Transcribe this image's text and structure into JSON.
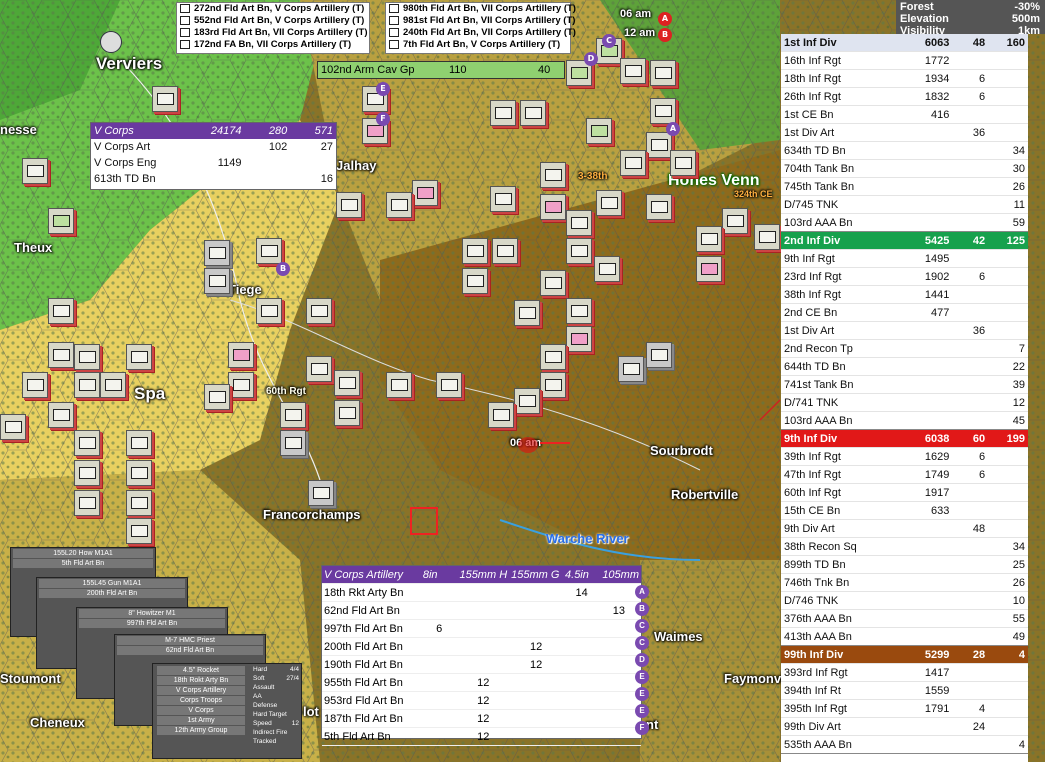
{
  "weather": {
    "terrain": "Forest",
    "terrain_value": "-30%",
    "elevation_label": "Elevation",
    "elevation_value": "500m",
    "visibility_label": "Visibility",
    "visibility_value": "1km"
  },
  "top_tooltip_left": [
    "272nd Fld Art Bn, V Corps Artillery (T)",
    "552nd Fld Art Bn, V Corps Artillery (T)",
    "183rd Fld Art Bn, VII Corps Artillery (T)",
    "172nd FA Bn, VII Corps Artillery (T)"
  ],
  "top_tooltip_right": [
    "980th Fld Art Bn, VII Corps Artillery (T)",
    "981st Fld Art Bn, VII Corps Artillery (T)",
    "240th Fld Art Bn, VII Corps Artillery (T)",
    "7th Fld Art Bn, V Corps Artillery (T)"
  ],
  "cav_bar": {
    "name": "102nd Arm Cav Gp",
    "v1": "110",
    "v2": "40"
  },
  "vcorps": {
    "header": [
      "V Corps",
      "24174",
      "280",
      "571"
    ],
    "rows": [
      [
        "V Corps Art",
        "",
        "102",
        "27"
      ],
      [
        "V Corps Eng",
        "1149",
        "",
        ""
      ],
      [
        "613th TD Bn",
        "",
        "",
        "16"
      ]
    ]
  },
  "towns": [
    "Verviers",
    "nesse",
    "Jalhay",
    "Hohes Venn",
    "Theux",
    "Tiege",
    "Spa",
    "60th Rgt",
    "Francorchamps",
    "Warche River",
    "Sourbrodt",
    "Robertville",
    "Waimes",
    "Faymonville",
    "Stoumont",
    "Cheneux",
    "lot",
    "nt",
    "3-38th",
    "324th CE"
  ],
  "time_labels": [
    "06 am",
    "12 am",
    "06 am"
  ],
  "oob": [
    {
      "cls": "d1",
      "name": "1st Inf Div",
      "a": "6063",
      "b": "48",
      "c": "160",
      "rows": [
        [
          "16th Inf Rgt",
          "1772",
          "",
          ""
        ],
        [
          "18th Inf Rgt",
          "1934",
          "6",
          ""
        ],
        [
          "26th Inf Rgt",
          "1832",
          "6",
          ""
        ],
        [
          "1st CE Bn",
          "416",
          "",
          ""
        ],
        [
          "1st Div Art",
          "",
          "36",
          ""
        ],
        [
          "634th TD Bn",
          "",
          "",
          "34"
        ],
        [
          "704th Tank Bn",
          "",
          "",
          "30"
        ],
        [
          "745th Tank Bn",
          "",
          "",
          "26"
        ],
        [
          "D/745 TNK",
          "",
          "",
          "11"
        ],
        [
          "103rd AAA Bn",
          "",
          "",
          "59"
        ]
      ]
    },
    {
      "cls": "d2",
      "name": "2nd Inf Div",
      "a": "5425",
      "b": "42",
      "c": "125",
      "rows": [
        [
          "9th Inf Rgt",
          "1495",
          "",
          ""
        ],
        [
          "23rd Inf Rgt",
          "1902",
          "6",
          ""
        ],
        [
          "38th Inf Rgt",
          "1441",
          "",
          ""
        ],
        [
          "2nd CE Bn",
          "477",
          "",
          ""
        ],
        [
          "1st Div Art",
          "",
          "36",
          ""
        ],
        [
          "2nd Recon Tp",
          "",
          "",
          "7"
        ],
        [
          "644th TD Bn",
          "",
          "",
          "22"
        ],
        [
          "741st Tank Bn",
          "",
          "",
          "39"
        ],
        [
          "D/741 TNK",
          "",
          "",
          "12"
        ],
        [
          "103rd AAA Bn",
          "",
          "",
          "45"
        ]
      ]
    },
    {
      "cls": "d9",
      "name": "9th Inf Div",
      "a": "6038",
      "b": "60",
      "c": "199",
      "rows": [
        [
          "39th Inf Rgt",
          "1629",
          "6",
          ""
        ],
        [
          "47th Inf Rgt",
          "1749",
          "6",
          ""
        ],
        [
          "60th Inf Rgt",
          "1917",
          "",
          ""
        ],
        [
          "15th CE Bn",
          "633",
          "",
          ""
        ],
        [
          "9th Div Art",
          "",
          "48",
          ""
        ],
        [
          "38th Recon Sq",
          "",
          "",
          "34"
        ],
        [
          "899th TD Bn",
          "",
          "",
          "25"
        ],
        [
          "746th Tnk Bn",
          "",
          "",
          "26"
        ],
        [
          "D/746 TNK",
          "",
          "",
          "10"
        ],
        [
          "376th AAA Bn",
          "",
          "",
          "55"
        ],
        [
          "413th AAA Bn",
          "",
          "",
          "49"
        ]
      ]
    },
    {
      "cls": "d99",
      "name": "99th Inf Div",
      "a": "5299",
      "b": "28",
      "c": "4",
      "rows": [
        [
          "393rd Inf Rgt",
          "1417",
          "",
          ""
        ],
        [
          "394th Inf Rt",
          "1559",
          "",
          ""
        ],
        [
          "395th Inf Rgt",
          "1791",
          "4",
          ""
        ],
        [
          "99th Div Art",
          "",
          "24",
          ""
        ],
        [
          "535th AAA Bn",
          "",
          "",
          "4"
        ]
      ]
    }
  ],
  "artillery": {
    "header": [
      "V Corps Artillery",
      "8in",
      "155mm H",
      "155mm G",
      "4.5in",
      "105mm"
    ],
    "rows": [
      [
        "18th Rkt Arty Bn",
        "",
        "",
        "",
        "14",
        "",
        "A"
      ],
      [
        "62nd Fld Art Bn",
        "",
        "",
        "",
        "",
        "13",
        "B"
      ],
      [
        "997th Fld Art Bn",
        "6",
        "",
        "",
        "",
        "",
        "C"
      ],
      [
        "200th Fld Art Bn",
        "",
        "",
        "12",
        "",
        "",
        "C"
      ],
      [
        "190th Fld Art Bn",
        "",
        "",
        "12",
        "",
        "",
        "D"
      ],
      [
        "955th Fld Art Bn",
        "",
        "12",
        "",
        "",
        "",
        "E"
      ],
      [
        "953rd Fld Art Bn",
        "",
        "12",
        "",
        "",
        "",
        "E"
      ],
      [
        "187th Fld Art Bn",
        "",
        "12",
        "",
        "",
        "",
        "E"
      ],
      [
        "5th Fld Art Bn",
        "",
        "12",
        "",
        "",
        "",
        "F"
      ]
    ]
  },
  "stack_cards": [
    {
      "title": "155L20 How M1A1",
      "rows": [
        "5th Fld Art Bn"
      ]
    },
    {
      "title": "155L45 Gun M1A1",
      "rows": [
        "200th Fld Art Bn"
      ]
    },
    {
      "title": "8\" Howitzer M1",
      "rows": [
        "997th Fld Art Bn"
      ]
    },
    {
      "title": "M-7 HMC Priest",
      "rows": [
        "62nd Fld Art Bn"
      ]
    },
    {
      "title": "4.5\" Rocket",
      "rows": [
        "18th Rokt Arty Bn",
        "V Corps Artillery",
        "Corps Troops",
        "V Corps",
        "1st Army",
        "12th Army Group"
      ]
    }
  ],
  "stats_card": {
    "labels": [
      "Hard",
      "Soft",
      "Assault",
      "AA",
      "Defense",
      "Hard Target",
      "Speed",
      "Indirect Fire",
      "Tracked"
    ],
    "values": [
      "4/4",
      "27/4",
      "",
      "",
      "",
      "",
      "12",
      "",
      ""
    ]
  }
}
